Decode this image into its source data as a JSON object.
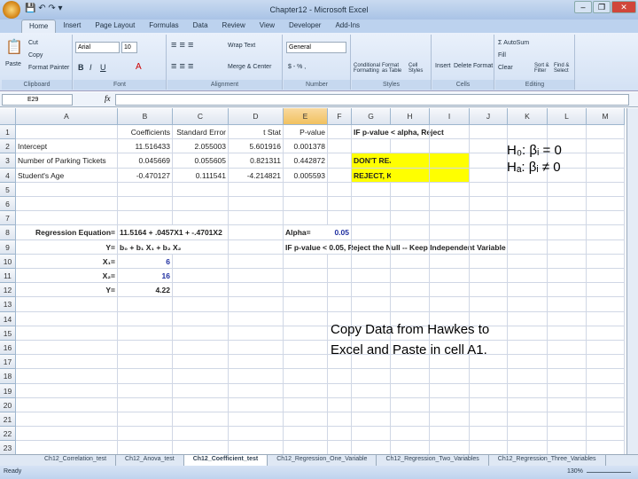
{
  "window": {
    "title": "Chapter12 - Microsoft Excel",
    "qat": "💾 ↶ ↷ ▾",
    "min": "–",
    "max": "❐",
    "close": "✕"
  },
  "ribbon_tabs": [
    "Home",
    "Insert",
    "Page Layout",
    "Formulas",
    "Data",
    "Review",
    "View",
    "Developer",
    "Add-Ins"
  ],
  "ribbon": {
    "clipboard": {
      "label": "Clipboard",
      "paste": "Paste",
      "cut": "Cut",
      "copy": "Copy",
      "format_painter": "Format Painter"
    },
    "font": {
      "label": "Font",
      "name": "Arial",
      "size": "10",
      "bold": "B",
      "italic": "I",
      "underline": "U"
    },
    "alignment": {
      "label": "Alignment",
      "wrap": "Wrap Text",
      "merge": "Merge & Center"
    },
    "number": {
      "label": "Number",
      "format": "General",
      "currency": "$ - % ,"
    },
    "styles": {
      "label": "Styles",
      "conditional": "Conditional Formatting",
      "format_table": "Format as Table",
      "cell_styles": "Cell Styles"
    },
    "cells": {
      "label": "Cells",
      "insert": "Insert",
      "delete": "Delete",
      "format": "Format"
    },
    "editing": {
      "label": "Editing",
      "autosum": "Σ AutoSum",
      "fill": "Fill",
      "clear": "Clear",
      "sort": "Sort & Filter",
      "find": "Find & Select"
    }
  },
  "formula_bar": {
    "name_box": "E29",
    "fx": "fx",
    "value": ""
  },
  "columns": [
    "A",
    "B",
    "C",
    "D",
    "E",
    "F",
    "G",
    "H",
    "I",
    "J",
    "K",
    "L",
    "M"
  ],
  "selected_column": "E",
  "rows": [
    {
      "B": "Coefficients",
      "C": "Standard Error",
      "D": "t Stat",
      "E": "P-value",
      "G": "IF p-value < alpha, Reject"
    },
    {
      "A": "Intercept",
      "B": "11.516433",
      "C": "2.055003",
      "D": "5.601916",
      "E": "0.001378"
    },
    {
      "A": "Number of Parking Tickets",
      "B": "0.045669",
      "C": "0.055605",
      "D": "0.821311",
      "E": "0.442872",
      "G": "DON'T REJECT, DISCARD"
    },
    {
      "A": "Student's Age",
      "B": "-0.470127",
      "C": "0.111541",
      "D": "-4.214821",
      "E": "0.005593",
      "G": "REJECT, KEEP VARIABLE"
    },
    {},
    {},
    {},
    {
      "A": "Regression Equation=",
      "B": "11.5164 + .0457X1 + -.4701X2",
      "E": "Alpha=",
      "F": "0.05"
    },
    {
      "A": "Y=",
      "B": "b₀ + b₁ X₁ +  b₂ X₂",
      "E": "IF p-value < 0.05, Reject the Null -- Keep Independent Variable"
    },
    {
      "A": "X₁=",
      "B": "6"
    },
    {
      "A": "X₂=",
      "B": "16"
    },
    {
      "A": "Y=",
      "B": "4.22"
    },
    {},
    {},
    {},
    {},
    {},
    {},
    {},
    {},
    {},
    {},
    {}
  ],
  "hypotheses": {
    "h0": "H₀: βᵢ = 0",
    "ha": "Hₐ: βᵢ ≠ 0"
  },
  "note": {
    "line1": "Copy Data from Hawkes to",
    "line2": "Excel and Paste in cell A1."
  },
  "sheet_tabs": [
    "Ch12_Correlation_test",
    "Ch12_Anova_test",
    "Ch12_Coefficient_test",
    "Ch12_Regression_One_Variable",
    "Ch12_Regression_Two_Variables",
    "Ch12_Regression_Three_Variables"
  ],
  "active_sheet": "Ch12_Coefficient_test",
  "status": {
    "ready": "Ready",
    "zoom": "130%"
  },
  "colors": {
    "highlight": "#ffff00",
    "blue_value": "#1f2fa0",
    "selected_header": "#f1c15f"
  }
}
